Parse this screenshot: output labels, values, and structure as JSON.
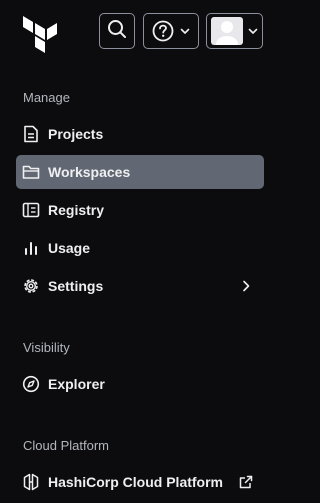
{
  "topbar": {
    "logo": "terraform-logo-icon",
    "search_icon": "search-icon",
    "help_icon": "help-circle-icon",
    "user_icon": "user-avatar-icon"
  },
  "sections": {
    "manage": "Manage",
    "visibility": "Visibility",
    "cloud_platform": "Cloud Platform"
  },
  "nav": {
    "projects": "Projects",
    "workspaces": "Workspaces",
    "registry": "Registry",
    "usage": "Usage",
    "settings": "Settings",
    "explorer": "Explorer",
    "hcp": "HashiCorp Cloud Platform"
  },
  "colors": {
    "background": "#0c0c0e",
    "active_item": "#626873",
    "section_text": "#b2b6bd",
    "text": "#efeff1"
  }
}
